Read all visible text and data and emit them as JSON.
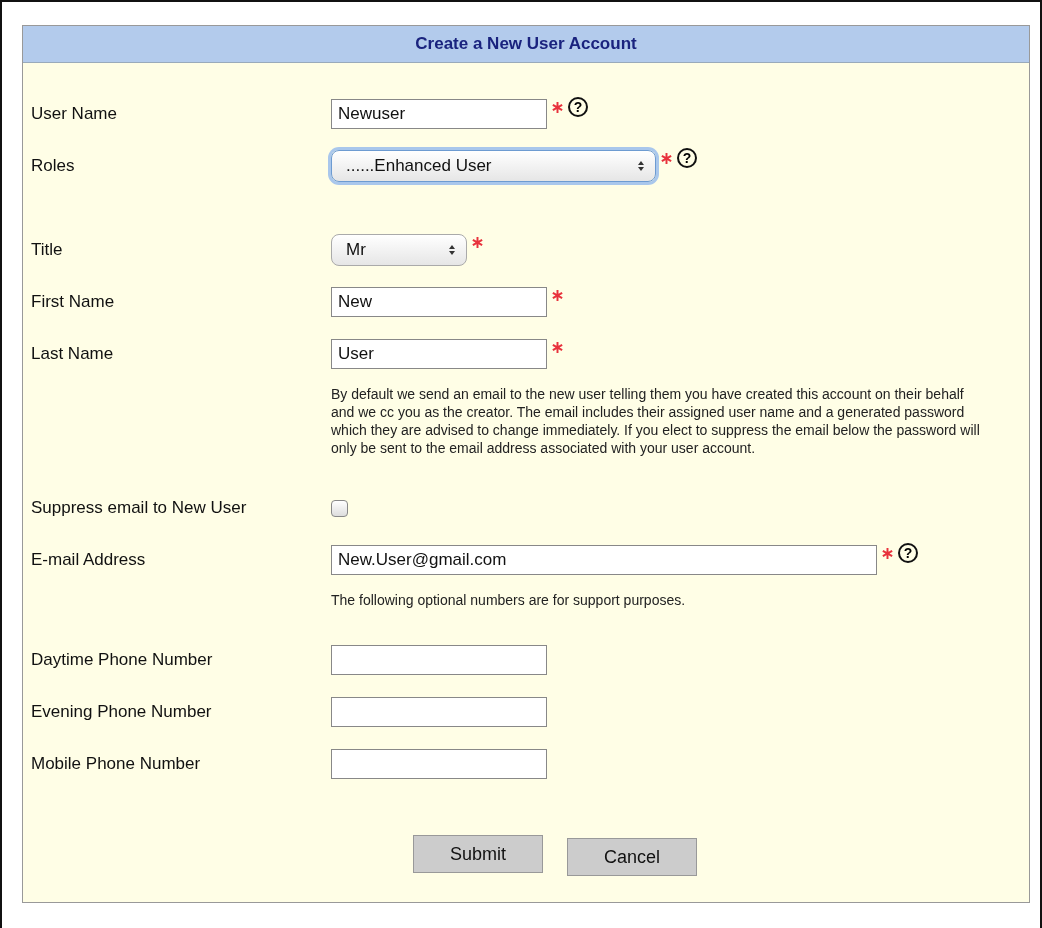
{
  "form": {
    "title": "Create a New User Account",
    "rows": [
      {
        "kind": "text",
        "label": "User Name",
        "value": "Newuser",
        "required": true,
        "help": "?"
      },
      {
        "kind": "select",
        "label": "Roles",
        "value": "......Enhanced User",
        "required": true,
        "help": "?",
        "focused": true
      },
      {
        "kind": "select",
        "label": "Title",
        "value": "Mr",
        "required": true,
        "focused": false
      },
      {
        "kind": "text",
        "label": "First Name",
        "value": "New",
        "required": true
      },
      {
        "kind": "text",
        "label": "Last Name",
        "value": "User",
        "required": true
      },
      {
        "kind": "note",
        "text": "By default we send an email to the new user telling them you have created this account on their behalf and we cc you as the creator. The email includes their assigned user name and a generated password which they are advised to change immediately. If you elect to suppress the email below the password will only be sent to the email address associated with your user account."
      },
      {
        "kind": "checkbox",
        "label": "Suppress email to New User",
        "checked": false
      },
      {
        "kind": "text",
        "label": "E-mail Address",
        "value": "New.User@gmail.com",
        "required": true,
        "help": "?"
      },
      {
        "kind": "note",
        "text": "The following optional numbers are for support purposes."
      },
      {
        "kind": "text",
        "label": "Daytime Phone Number",
        "value": "",
        "required": false
      },
      {
        "kind": "text",
        "label": "Evening Phone Number",
        "value": "",
        "required": false
      },
      {
        "kind": "text",
        "label": "Mobile Phone Number",
        "value": "",
        "required": false
      }
    ],
    "buttons": [
      "Submit",
      "Cancel"
    ]
  }
}
